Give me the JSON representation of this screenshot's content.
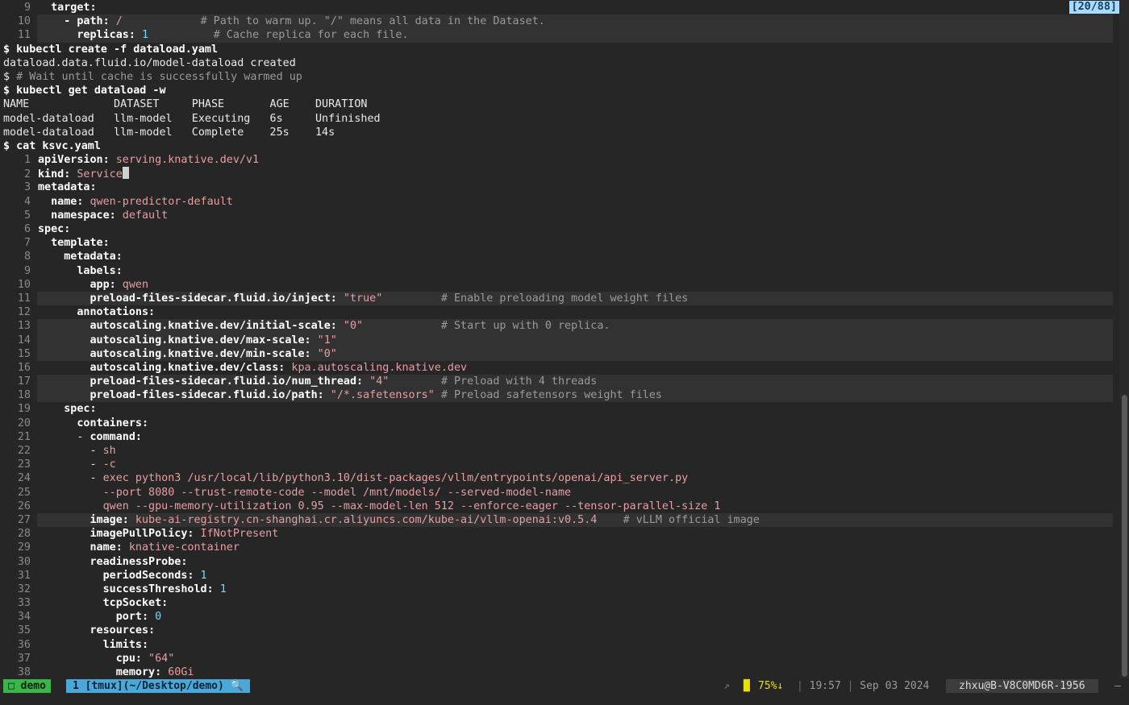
{
  "scroll_position": "[20/88]",
  "lines": [
    [
      {
        "c": "ln",
        "t": "9"
      },
      {
        "c": "t",
        "t": "  "
      },
      {
        "c": "k",
        "t": "target:"
      }
    ],
    [
      {
        "c": "ln",
        "t": "10"
      },
      {
        "c": "t",
        "t": "    "
      },
      {
        "c": "k",
        "t": "- path:"
      },
      {
        "c": "v",
        "t": " /            "
      },
      {
        "c": "c",
        "t": "# Path to warm up. \"/\" means all data in the Dataset."
      }
    ],
    [
      {
        "c": "ln",
        "t": "11"
      },
      {
        "c": "t",
        "t": "      "
      },
      {
        "c": "k",
        "t": "replicas:"
      },
      {
        "c": "n",
        "t": " 1"
      },
      {
        "c": "t",
        "t": "          "
      },
      {
        "c": "c",
        "t": "# Cache replica for each file."
      }
    ],
    [
      {
        "c": "p",
        "t": "$ kubectl create -f dataload.yaml"
      }
    ],
    [
      {
        "c": "t",
        "t": "dataload.data.fluid.io/model-dataload created"
      }
    ],
    [
      {
        "c": "t",
        "t": "$ "
      },
      {
        "c": "c",
        "t": "# Wait until cache is successfully warmed up"
      }
    ],
    [
      {
        "c": "p",
        "t": "$ kubectl get dataload -w"
      }
    ],
    [
      {
        "c": "t",
        "t": "NAME             DATASET     PHASE       AGE    DURATION"
      }
    ],
    [
      {
        "c": "t",
        "t": "model-dataload   llm-model   Executing   6s     Unfinished"
      }
    ],
    [
      {
        "c": "t",
        "t": "model-dataload   llm-model   Complete    25s    14s"
      }
    ],
    [
      {
        "c": "p",
        "t": "$ cat ksvc.yaml"
      }
    ],
    [
      {
        "c": "ln",
        "t": "1"
      },
      {
        "c": "k",
        "t": "apiVersion:"
      },
      {
        "c": "v",
        "t": " serving.knative.dev/v1"
      }
    ],
    [
      {
        "c": "ln",
        "t": "2"
      },
      {
        "c": "k",
        "t": "kind:"
      },
      {
        "c": "v",
        "t": " Service"
      },
      {
        "c": "cursor",
        "t": ""
      }
    ],
    [
      {
        "c": "ln",
        "t": "3"
      },
      {
        "c": "k",
        "t": "metadata:"
      }
    ],
    [
      {
        "c": "ln",
        "t": "4"
      },
      {
        "c": "t",
        "t": "  "
      },
      {
        "c": "k",
        "t": "name:"
      },
      {
        "c": "v",
        "t": " qwen-predictor-default"
      }
    ],
    [
      {
        "c": "ln",
        "t": "5"
      },
      {
        "c": "t",
        "t": "  "
      },
      {
        "c": "k",
        "t": "namespace:"
      },
      {
        "c": "v",
        "t": " default"
      }
    ],
    [
      {
        "c": "ln",
        "t": "6"
      },
      {
        "c": "k",
        "t": "spec:"
      }
    ],
    [
      {
        "c": "ln",
        "t": "7"
      },
      {
        "c": "t",
        "t": "  "
      },
      {
        "c": "k",
        "t": "template:"
      }
    ],
    [
      {
        "c": "ln",
        "t": "8"
      },
      {
        "c": "t",
        "t": "    "
      },
      {
        "c": "k",
        "t": "metadata:"
      }
    ],
    [
      {
        "c": "ln",
        "t": "9"
      },
      {
        "c": "t",
        "t": "      "
      },
      {
        "c": "k",
        "t": "labels:"
      }
    ],
    [
      {
        "c": "ln",
        "t": "10"
      },
      {
        "c": "t",
        "t": "        "
      },
      {
        "c": "k",
        "t": "app:"
      },
      {
        "c": "v",
        "t": " qwen"
      }
    ],
    [
      {
        "c": "ln",
        "t": "11"
      },
      {
        "c": "t",
        "t": "        "
      },
      {
        "c": "k",
        "t": "preload-files-sidecar.fluid.io/inject:"
      },
      {
        "c": "v",
        "t": " \"true\"         "
      },
      {
        "c": "c",
        "t": "# Enable preloading model weight files"
      }
    ],
    [
      {
        "c": "ln",
        "t": "12"
      },
      {
        "c": "t",
        "t": "      "
      },
      {
        "c": "k",
        "t": "annotations:"
      }
    ],
    [
      {
        "c": "ln",
        "t": "13"
      },
      {
        "c": "t",
        "t": "        "
      },
      {
        "c": "k",
        "t": "autoscaling.knative.dev/initial-scale:"
      },
      {
        "c": "v",
        "t": " \"0\"            "
      },
      {
        "c": "c",
        "t": "# Start up with 0 replica."
      }
    ],
    [
      {
        "c": "ln",
        "t": "14"
      },
      {
        "c": "t",
        "t": "        "
      },
      {
        "c": "k",
        "t": "autoscaling.knative.dev/max-scale:"
      },
      {
        "c": "v",
        "t": " \"1\""
      }
    ],
    [
      {
        "c": "ln",
        "t": "15"
      },
      {
        "c": "t",
        "t": "        "
      },
      {
        "c": "k",
        "t": "autoscaling.knative.dev/min-scale:"
      },
      {
        "c": "v",
        "t": " \"0\""
      }
    ],
    [
      {
        "c": "ln",
        "t": "16"
      },
      {
        "c": "t",
        "t": "        "
      },
      {
        "c": "k",
        "t": "autoscaling.knative.dev/class:"
      },
      {
        "c": "v",
        "t": " kpa.autoscaling.knative.dev"
      }
    ],
    [
      {
        "c": "ln",
        "t": "17"
      },
      {
        "c": "t",
        "t": "        "
      },
      {
        "c": "k",
        "t": "preload-files-sidecar.fluid.io/num_thread:"
      },
      {
        "c": "v",
        "t": " \"4\"        "
      },
      {
        "c": "c",
        "t": "# Preload with 4 threads"
      }
    ],
    [
      {
        "c": "ln",
        "t": "18"
      },
      {
        "c": "t",
        "t": "        "
      },
      {
        "c": "k",
        "t": "preload-files-sidecar.fluid.io/path:"
      },
      {
        "c": "v",
        "t": " \"/*.safetensors\" "
      },
      {
        "c": "c",
        "t": "# Preload safetensors weight files"
      }
    ],
    [
      {
        "c": "ln",
        "t": "19"
      },
      {
        "c": "t",
        "t": "    "
      },
      {
        "c": "k",
        "t": "spec:"
      }
    ],
    [
      {
        "c": "ln",
        "t": "20"
      },
      {
        "c": "t",
        "t": "      "
      },
      {
        "c": "k",
        "t": "containers:"
      }
    ],
    [
      {
        "c": "ln",
        "t": "21"
      },
      {
        "c": "t",
        "t": "      - "
      },
      {
        "c": "k",
        "t": "command:"
      }
    ],
    [
      {
        "c": "ln",
        "t": "22"
      },
      {
        "c": "t",
        "t": "        - "
      },
      {
        "c": "v",
        "t": "sh"
      }
    ],
    [
      {
        "c": "ln",
        "t": "23"
      },
      {
        "c": "t",
        "t": "        - "
      },
      {
        "c": "v",
        "t": "-c"
      }
    ],
    [
      {
        "c": "ln",
        "t": "24"
      },
      {
        "c": "t",
        "t": "        - "
      },
      {
        "c": "v",
        "t": "exec python3 /usr/local/lib/python3.10/dist-packages/vllm/entrypoints/openai/api_server.py"
      }
    ],
    [
      {
        "c": "ln",
        "t": "25"
      },
      {
        "c": "v",
        "t": "          --port 8080 --trust-remote-code --model /mnt/models/ --served-model-name"
      }
    ],
    [
      {
        "c": "ln",
        "t": "26"
      },
      {
        "c": "v",
        "t": "          qwen --gpu-memory-utilization 0.95 --max-model-len 512 --enforce-eager --tensor-parallel-size 1"
      }
    ],
    [
      {
        "c": "ln",
        "t": "27"
      },
      {
        "c": "t",
        "t": "        "
      },
      {
        "c": "k",
        "t": "image:"
      },
      {
        "c": "v",
        "t": " kube-ai-registry.cn-shanghai.cr.aliyuncs.com/kube-ai/vllm-openai:v0.5.4    "
      },
      {
        "c": "c",
        "t": "# vLLM official image"
      }
    ],
    [
      {
        "c": "ln",
        "t": "28"
      },
      {
        "c": "t",
        "t": "        "
      },
      {
        "c": "k",
        "t": "imagePullPolicy:"
      },
      {
        "c": "v",
        "t": " IfNotPresent"
      }
    ],
    [
      {
        "c": "ln",
        "t": "29"
      },
      {
        "c": "t",
        "t": "        "
      },
      {
        "c": "k",
        "t": "name:"
      },
      {
        "c": "v",
        "t": " knative-container"
      }
    ],
    [
      {
        "c": "ln",
        "t": "30"
      },
      {
        "c": "t",
        "t": "        "
      },
      {
        "c": "k",
        "t": "readinessProbe:"
      }
    ],
    [
      {
        "c": "ln",
        "t": "31"
      },
      {
        "c": "t",
        "t": "          "
      },
      {
        "c": "k",
        "t": "periodSeconds:"
      },
      {
        "c": "n",
        "t": " 1"
      }
    ],
    [
      {
        "c": "ln",
        "t": "32"
      },
      {
        "c": "t",
        "t": "          "
      },
      {
        "c": "k",
        "t": "successThreshold:"
      },
      {
        "c": "n",
        "t": " 1"
      }
    ],
    [
      {
        "c": "ln",
        "t": "33"
      },
      {
        "c": "t",
        "t": "          "
      },
      {
        "c": "k",
        "t": "tcpSocket:"
      }
    ],
    [
      {
        "c": "ln",
        "t": "34"
      },
      {
        "c": "t",
        "t": "            "
      },
      {
        "c": "k",
        "t": "port:"
      },
      {
        "c": "n",
        "t": " 0"
      }
    ],
    [
      {
        "c": "ln",
        "t": "35"
      },
      {
        "c": "t",
        "t": "        "
      },
      {
        "c": "k",
        "t": "resources:"
      }
    ],
    [
      {
        "c": "ln",
        "t": "36"
      },
      {
        "c": "t",
        "t": "          "
      },
      {
        "c": "k",
        "t": "limits:"
      }
    ],
    [
      {
        "c": "ln",
        "t": "37"
      },
      {
        "c": "t",
        "t": "            "
      },
      {
        "c": "k",
        "t": "cpu:"
      },
      {
        "c": "v",
        "t": " \"64\""
      }
    ],
    [
      {
        "c": "ln",
        "t": "38"
      },
      {
        "c": "t",
        "t": "            "
      },
      {
        "c": "k",
        "t": "memory:"
      },
      {
        "c": "v",
        "t": " 60Gi"
      }
    ]
  ],
  "highlighted_lines": [
    1,
    2,
    21,
    23,
    24,
    25,
    27,
    28,
    37
  ],
  "status": {
    "session": "□ demo",
    "window": "1 [tmux](~/Desktop/demo) 🔍",
    "arrow": "↗",
    "battery_icon": "█",
    "battery": "75%↓",
    "sep": "|",
    "time": "19:57",
    "date": "Sep 03 2024",
    "host": "zhxu@B-V8C0MD6R-1956",
    "tail": "–"
  },
  "colors": {
    "background": "#262626",
    "key": "#ffffff",
    "value": "#e79fa1",
    "number": "#7fd3ff",
    "comment": "#9a9a9a",
    "session_badge": "#3bb54a",
    "window_badge": "#4aa8d8"
  }
}
